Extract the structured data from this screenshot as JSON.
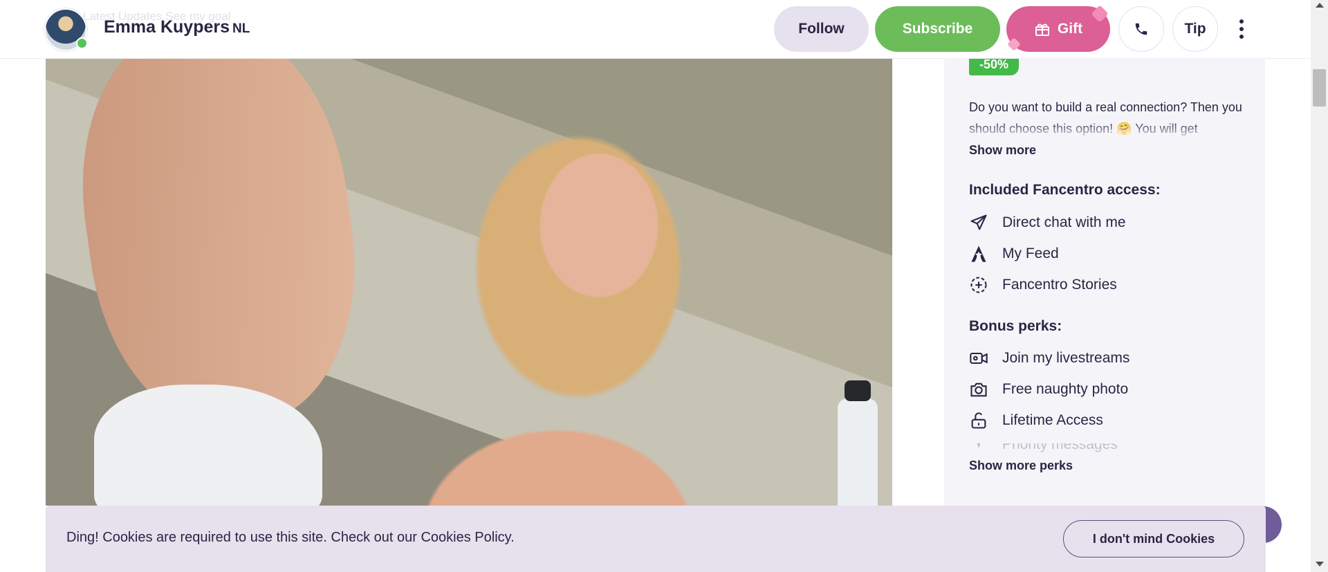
{
  "header": {
    "ghost_text": "Latest Updates    See my goal",
    "creator_name": "Emma Kuypers",
    "country_code": "NL",
    "follow_label": "Follow",
    "subscribe_label": "Subscribe",
    "gift_label": "Gift",
    "tip_label": "Tip"
  },
  "offer": {
    "discount_badge": "-50%",
    "description": "Do you want to build a real connection? Then you should choose this option! 🤗 You will get",
    "show_more_label": "Show more",
    "included_title": "Included Fancentro access:",
    "included": [
      {
        "icon": "send-icon",
        "label": "Direct chat with me"
      },
      {
        "icon": "feed-star-icon",
        "label": "My Feed"
      },
      {
        "icon": "stories-plus-icon",
        "label": "Fancentro Stories"
      }
    ],
    "bonus_title": "Bonus perks:",
    "bonus": [
      {
        "icon": "video-icon",
        "label": "Join my livestreams"
      },
      {
        "icon": "camera-icon",
        "label": "Free naughty photo"
      },
      {
        "icon": "lock-open-icon",
        "label": "Lifetime Access"
      },
      {
        "icon": "sparkle-icon",
        "label": "Priority messages"
      }
    ],
    "show_more_perks_label": "Show more perks"
  },
  "cookie_banner": {
    "text": "Ding! Cookies are required to use this site. Check out our Cookies Policy.",
    "accept_label": "I don't mind Cookies"
  },
  "colors": {
    "text": "#2b2443",
    "follow_bg": "#e6e1ee",
    "subscribe_bg": "#6cbd5a",
    "gift_bg": "#dc5f95",
    "discount_bg": "#43b94a",
    "panel_bg": "#f5f5f9",
    "cookie_bg": "#e7e1ee"
  }
}
